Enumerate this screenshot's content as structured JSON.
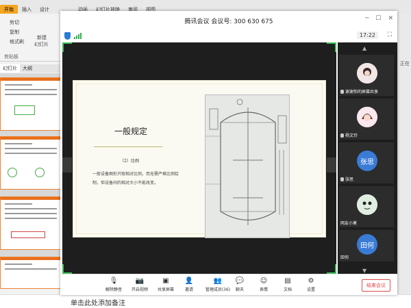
{
  "ppt": {
    "tabs": [
      {
        "label": "开始",
        "active": true
      },
      {
        "label": "插入",
        "active": false
      },
      {
        "label": "设计",
        "active": false
      },
      {
        "label": "动画",
        "active": false
      },
      {
        "label": "幻灯片放映",
        "active": false
      },
      {
        "label": "审阅",
        "active": false
      },
      {
        "label": "视图",
        "active": false
      }
    ],
    "ribbon": {
      "cut": "剪切",
      "copy": "复制",
      "format_painter": "格式刷",
      "new_slide": "新建",
      "new_slide_2": "幻灯片",
      "clipboard_group": "剪贴板"
    },
    "left_tabs": [
      "幻灯片",
      "大纲"
    ],
    "right_label": "正在",
    "notes_placeholder": "单击此处添加备注"
  },
  "meeting": {
    "title": "腾讯会议 会议号: 300 630 675",
    "time": "17:22",
    "slide": {
      "title": "一般规定",
      "subtitle": "（2）比例",
      "body": "一般设备图形只取相对比例，而无需严格比例绘制，但设备间的相对大小不能改变。"
    },
    "participants": [
      {
        "name": "谢谢你的屏幕共享",
        "avatar": "",
        "color": "#f2c9c9"
      },
      {
        "name": "杨文玲",
        "avatar": "",
        "color": "#f5d8e0"
      },
      {
        "name": "张思",
        "avatar": "张思",
        "color": "#3a7bd5"
      },
      {
        "name": "网友小莫",
        "avatar": "",
        "color": "#e8f0e8"
      },
      {
        "name": "田何",
        "avatar": "田何",
        "color": "#3a7bd5"
      }
    ],
    "toolbar": [
      {
        "label": "解除静音",
        "icon": "mic-muted-icon",
        "glyph": "🎙"
      },
      {
        "label": "开启视频",
        "icon": "video-off-icon",
        "glyph": "📷"
      },
      {
        "label": "共享屏幕",
        "icon": "share-screen-icon",
        "glyph": "▣"
      },
      {
        "label": "邀请",
        "icon": "invite-icon",
        "glyph": "👤"
      },
      {
        "label": "管理成员(36)",
        "icon": "members-icon",
        "glyph": "👥"
      },
      {
        "label": "聊天",
        "icon": "chat-icon",
        "glyph": "💬"
      },
      {
        "label": "表情",
        "icon": "emoji-icon",
        "glyph": "☺"
      },
      {
        "label": "文档",
        "icon": "document-icon",
        "glyph": "▤"
      },
      {
        "label": "设置",
        "icon": "settings-icon",
        "glyph": "⚙"
      }
    ],
    "end_button": "结束会议"
  },
  "colors": {
    "accent_green": "#3fbf5c",
    "end_red": "#e04a4a",
    "ppt_orange": "#f6a623"
  }
}
